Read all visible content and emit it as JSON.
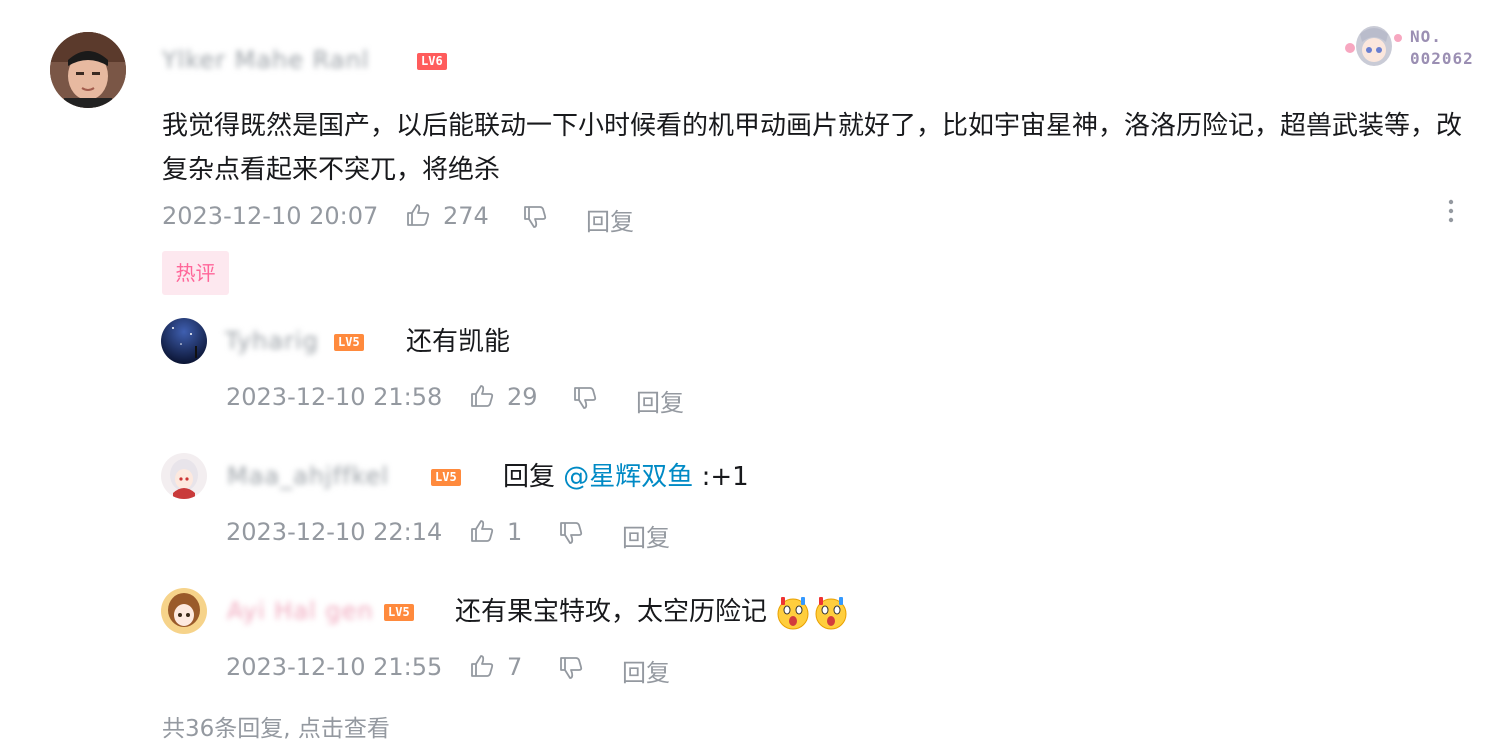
{
  "colors": {
    "lv6": "#ff5c5c",
    "lv5": "#ff8a3d",
    "mention": "#008ac5",
    "meta": "#9499a0",
    "hot_tag_bg": "#fde8ef",
    "hot_tag_text": "#ff6699"
  },
  "main_comment": {
    "username": "Ylker Mahe Ranl",
    "level": "LV6",
    "text": "我觉得既然是国产，以后能联动一下小时候看的机甲动画片就好了，比如宇宙星神，洛洛历险记，超兽武装等，改复杂点看起来不突兀，将绝杀",
    "timestamp": "2023-12-10 20:07",
    "likes": "274",
    "reply_label": "回复",
    "more_icon": "more-vertical-icon",
    "tag": "热评",
    "badge_no": "NO.",
    "badge_num": "002062"
  },
  "replies": [
    {
      "username": "Tyharig",
      "level": "LV5",
      "prefix": "",
      "mention": "",
      "text": "还有凯能",
      "timestamp": "2023-12-10 21:58",
      "likes": "29",
      "reply_label": "回复"
    },
    {
      "username": "Maa_ahjffkel",
      "level": "LV5",
      "prefix": "回复",
      "mention": "@星辉双鱼",
      "text": ":+1",
      "timestamp": "2023-12-10 22:14",
      "likes": "1",
      "reply_label": "回复"
    },
    {
      "username": "Ayi Hal gen",
      "level": "LV5",
      "prefix": "",
      "mention": "",
      "text": "还有果宝特攻，太空历险记",
      "emoji": "surprised-face-emoji",
      "timestamp": "2023-12-10 21:55",
      "likes": "7",
      "reply_label": "回复"
    }
  ],
  "footer": {
    "more_replies": "共36条回复, 点击查看"
  }
}
